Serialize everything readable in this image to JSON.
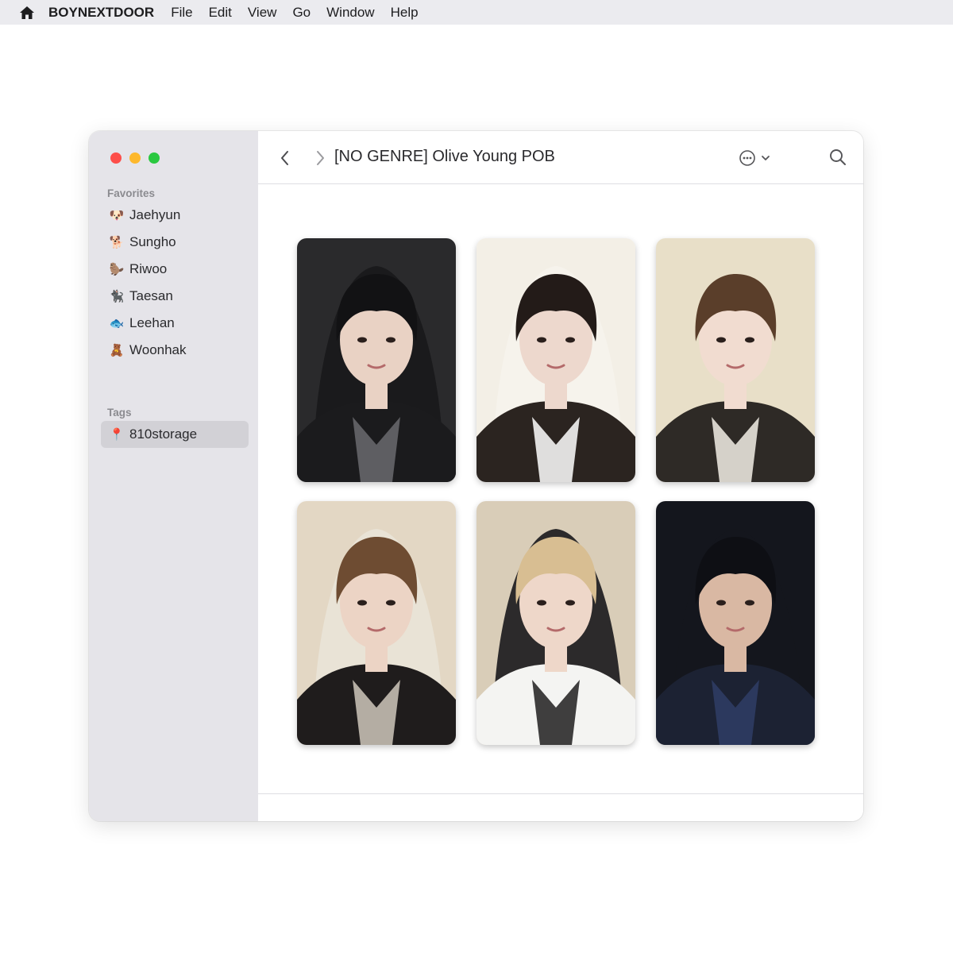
{
  "menubar": {
    "icon": "home-icon",
    "app_name": "BOYNEXTDOOR",
    "items": [
      "File",
      "Edit",
      "View",
      "Go",
      "Window",
      "Help"
    ]
  },
  "window": {
    "title": "[NO GENRE] Olive Young POB",
    "sidebar": {
      "favorites_heading": "Favorites",
      "favorites": [
        {
          "emoji": "🐶",
          "label": "Jaehyun"
        },
        {
          "emoji": "🐕",
          "label": "Sungho"
        },
        {
          "emoji": "🦫",
          "label": "Riwoo"
        },
        {
          "emoji": "🐈‍⬛",
          "label": "Taesan"
        },
        {
          "emoji": "🐟",
          "label": "Leehan"
        },
        {
          "emoji": "🧸",
          "label": "Woonhak"
        }
      ],
      "tags_heading": "Tags",
      "tags": [
        {
          "emoji": "📍",
          "label": "810storage",
          "selected": true
        }
      ]
    },
    "toolbar": {
      "back_icon": "chevron-left-icon",
      "forward_icon": "chevron-right-icon",
      "more_icon": "ellipsis-circle-icon",
      "search_icon": "search-icon"
    },
    "photocards": [
      {
        "name": "photocard-1",
        "bg": "#2a2a2c",
        "hood": "#1a1a1c",
        "hair": "#121214",
        "skin": "#e9d2c4",
        "shirt": "#1b1b1d",
        "accent": "#6a6a6e"
      },
      {
        "name": "photocard-2",
        "bg": "#f3efe6",
        "hood": "#f6f3ec",
        "hair": "#231b18",
        "skin": "#edd8cd",
        "shirt": "#2b2420",
        "accent": "#ffffff"
      },
      {
        "name": "photocard-3",
        "bg": "#e8dfc8",
        "hood": "#e8dfc8",
        "hair": "#5a3e2a",
        "skin": "#f1dcd0",
        "shirt": "#2e2a26",
        "accent": "#f2eee6"
      },
      {
        "name": "photocard-4",
        "bg": "#e3d7c4",
        "hood": "#e9e3d6",
        "hair": "#6e4c32",
        "skin": "#ecd4c5",
        "shirt": "#1f1c1c",
        "accent": "#cfc7bb"
      },
      {
        "name": "photocard-5",
        "bg": "#d9cdb8",
        "hood": "#2c2a2b",
        "hair": "#d8be92",
        "skin": "#eed7c9",
        "shirt": "#f4f4f2",
        "accent": "#1e1d1e"
      },
      {
        "name": "photocard-6",
        "bg": "#14161d",
        "hood": "#14161d",
        "hair": "#0e0f14",
        "skin": "#d9b8a3",
        "shirt": "#1c2233",
        "accent": "#2f3d66"
      }
    ]
  }
}
